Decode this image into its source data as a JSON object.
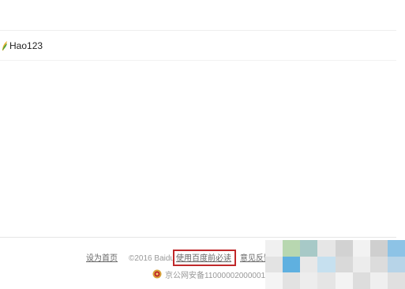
{
  "hao123": {
    "label": "Hao123",
    "icon": "hao123-leaf-icon"
  },
  "footer": {
    "homepage_link": "设为首页",
    "copyright": "©2016 Baidu",
    "terms_link": "使用百度前必读",
    "feedback_link": "意见反馈",
    "icp": "京公网安备11000002000001号",
    "police_icon": "police-badge-icon"
  },
  "colors": {
    "highlight_border": "#c0282a",
    "footer_text": "#999999",
    "divider": "#eeeeee"
  }
}
